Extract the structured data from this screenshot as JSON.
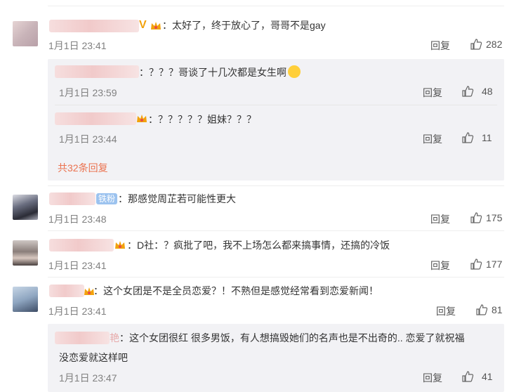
{
  "comments": [
    {
      "text": "：太好了，终于放心了，哥哥不是gay",
      "time": "1月1日 23:41",
      "reply": "回复",
      "likes": "282"
    },
    {
      "text": "：那感觉周芷若可能性更大",
      "fan_badge": "铁粉",
      "time": "1月1日 23:48",
      "reply": "回复",
      "likes": "175"
    },
    {
      "text": "：D社：？疯批了吧，我不上场怎么都来搞事情，还搞的冷饭",
      "time": "1月1日 23:41",
      "reply": "回复",
      "likes": "177"
    },
    {
      "text": "：这个女团是不是全员恋爱？！不熟但是感觉经常看到恋爱新闻！",
      "time": "1月1日 23:41",
      "reply": "回复",
      "likes": "81"
    }
  ],
  "replies": [
    {
      "text": "：？？？哥谈了十几次都是女生啊",
      "emoji": "laughing-tears-emoji",
      "time": "1月1日 23:59",
      "reply": "回复",
      "likes": "48"
    },
    {
      "text": "：？？？？？姐妹？？？",
      "time": "1月1日 23:44",
      "reply": "回复",
      "likes": "11"
    },
    {
      "text_line1": "：这个女团很红 很多男饭，有人想搞毁她们的名声也是不出奇的.. 恋爱了就祝福",
      "text_line2": "没恋爱就这样吧",
      "name_tail": "艳",
      "time": "1月1日 23:47",
      "reply": "回复",
      "likes": "41"
    }
  ],
  "more_replies": "共32条回复",
  "colors": {
    "link": "#eb7350",
    "subbox_bg": "#f2f2f5",
    "time": "#808080",
    "verified": "#f2a20c",
    "fan_badge": "#9cc3ef"
  }
}
